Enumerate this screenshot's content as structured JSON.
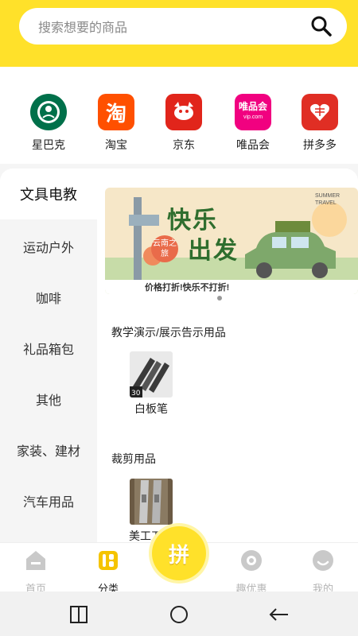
{
  "search": {
    "placeholder": "搜索想要的商品",
    "icon": "search-icon"
  },
  "brands": [
    {
      "label": "星巴克",
      "icon": "starbucks-logo",
      "color": "#00704a"
    },
    {
      "label": "淘宝",
      "icon": "taobao-logo",
      "color": "#ff5000",
      "glyph": "淘"
    },
    {
      "label": "京东",
      "icon": "jd-logo",
      "color": "#e1251b"
    },
    {
      "label": "唯品会",
      "icon": "vipshop-logo",
      "color": "#f10180",
      "glyph": "唯品会",
      "sub": "vip.com"
    },
    {
      "label": "拼多多",
      "icon": "pinduoduo-logo",
      "color": "#e02e24"
    }
  ],
  "sidebar": {
    "items": [
      {
        "label": "文具电教",
        "active": true
      },
      {
        "label": "运动户外"
      },
      {
        "label": "咖啡"
      },
      {
        "label": "礼品箱包"
      },
      {
        "label": "其他"
      },
      {
        "label": "家装、建材"
      },
      {
        "label": "汽车用品"
      }
    ]
  },
  "banner": {
    "headline_1": "快乐",
    "headline_2": "出发",
    "badge": "云南之旅",
    "tagline": "价格打折!快乐不打折!",
    "sign": "SUMMER TRAVEL"
  },
  "sections": [
    {
      "title": "教学演示/展示告示用品",
      "products": [
        {
          "name": "白板笔"
        }
      ]
    },
    {
      "title": "裁剪用品",
      "products": [
        {
          "name": "美工刀/开箱刀"
        }
      ]
    }
  ],
  "tabbar": {
    "items": [
      {
        "label": "首页",
        "icon": "home-icon"
      },
      {
        "label": "分类",
        "icon": "category-icon",
        "active": true
      },
      {
        "label": "趣优惠",
        "icon": "discount-icon"
      },
      {
        "label": "我的",
        "icon": "profile-icon"
      }
    ],
    "center": {
      "glyph": "拼"
    }
  },
  "colors": {
    "accent": "#ffe12a",
    "accent_dark": "#f5c400"
  }
}
